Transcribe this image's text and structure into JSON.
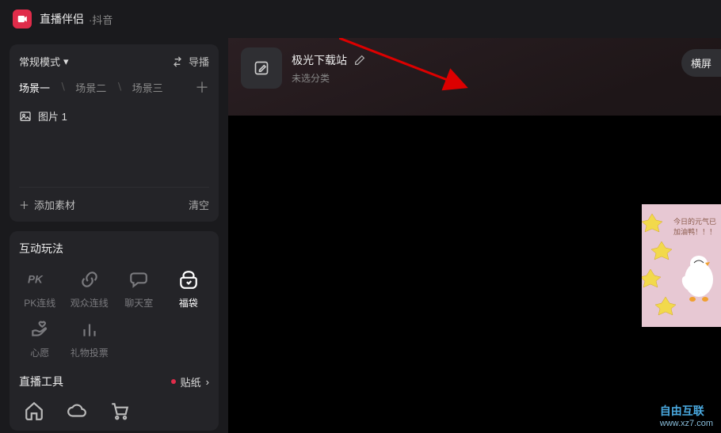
{
  "header": {
    "app_title": "直播伴侣",
    "app_sub": "·抖音"
  },
  "sidebar": {
    "mode_label": "常规模式",
    "switch_label": "导播",
    "scenes": [
      "场景一",
      "场景二",
      "场景三"
    ],
    "active_scene_index": 0,
    "layer_label": "图片 1",
    "add_material_label": "添加素材",
    "clear_label": "清空"
  },
  "interactive": {
    "title": "互动玩法",
    "items": [
      {
        "label": "PK连线",
        "icon": "pk"
      },
      {
        "label": "观众连线",
        "icon": "link"
      },
      {
        "label": "聊天室",
        "icon": "chat"
      },
      {
        "label": "福袋",
        "icon": "bag",
        "active": true
      },
      {
        "label": "心愿",
        "icon": "heart"
      },
      {
        "label": "礼物投票",
        "icon": "bar"
      }
    ]
  },
  "tools": {
    "title": "直播工具",
    "sticker_label": "贴纸"
  },
  "room": {
    "title": "极光下载站",
    "category": "未选分类",
    "orientation_label": "横屏"
  },
  "watermark": {
    "main": "自由互联",
    "sub": "www.xz7.com",
    "semi": "•"
  },
  "floating": {
    "line1": "今日的元气已",
    "line2": "加油鸭！！！"
  }
}
